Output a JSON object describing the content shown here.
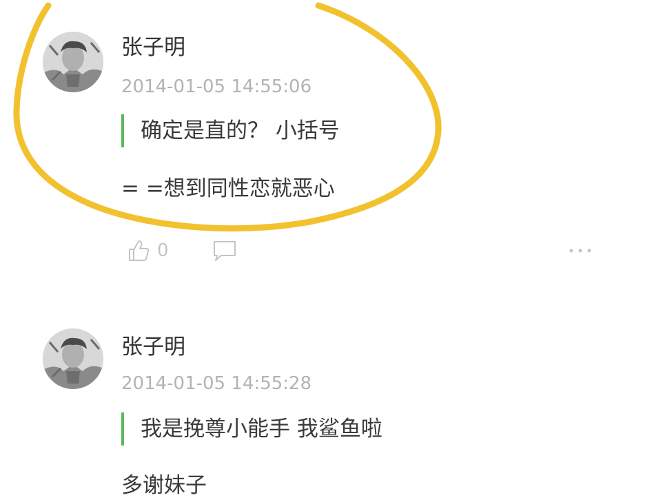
{
  "comments": [
    {
      "username": "张子明",
      "timestamp": "2014-01-05 14:55:06",
      "quoted_text": "确定是直的？ 小括号",
      "reply_text": "= =想到同性恋就恶心",
      "like_count": "0"
    },
    {
      "username": "张子明",
      "timestamp": "2014-01-05 14:55:28",
      "quoted_text": "我是挽尊小能手 我鲨鱼啦",
      "reply_text": "多谢妹子"
    }
  ],
  "icons": {
    "like": "thumbs-up-icon",
    "reply": "speech-bubble-icon",
    "more": "more-dots-icon"
  },
  "colors": {
    "background": "#ffffff",
    "quote_bar": "#5cb85c",
    "highlight_circle": "#f2c12e",
    "timestamp": "#b3b3b3",
    "text": "#3a3a3a"
  }
}
